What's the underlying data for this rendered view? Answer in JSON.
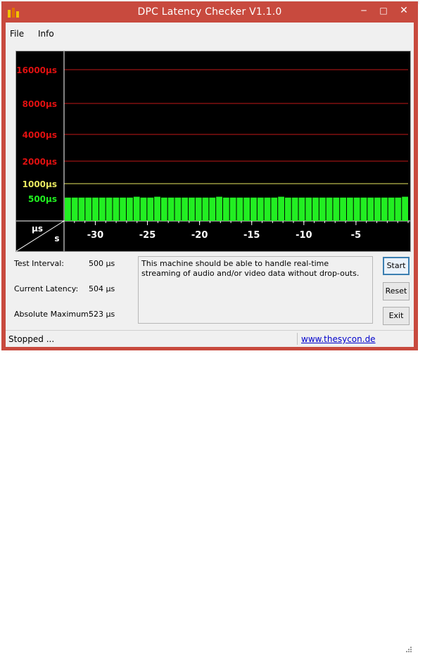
{
  "window": {
    "title": "DPC Latency Checker V1.1.0"
  },
  "menu": {
    "items": [
      "File",
      "Info"
    ]
  },
  "graph": {
    "y_labels": [
      {
        "text": "16000µs",
        "color": "#e01010"
      },
      {
        "text": "8000µs",
        "color": "#e01010"
      },
      {
        "text": "4000µs",
        "color": "#e01010"
      },
      {
        "text": "2000µs",
        "color": "#e01010"
      },
      {
        "text": "1000µs",
        "color": "#e8e860"
      },
      {
        "text": "500µs",
        "color": "#20f020"
      }
    ],
    "corner_top": "µs",
    "corner_bottom": "s",
    "x_ticks": [
      "-30",
      "-25",
      "-20",
      "-15",
      "-10",
      "-5"
    ],
    "bar_color": "#22ee22",
    "grid_colors": {
      "red": "#c01818",
      "yellow": "#e8e860"
    },
    "bars": [
      504,
      504,
      504,
      504,
      504,
      504,
      504,
      504,
      504,
      504,
      523,
      504,
      504,
      523,
      504,
      504,
      504,
      504,
      504,
      504,
      504,
      504,
      523,
      504,
      504,
      504,
      504,
      504,
      504,
      504,
      504,
      523,
      504,
      504,
      504,
      504,
      504,
      504,
      504,
      504,
      504,
      504,
      504,
      504,
      504,
      504,
      504,
      504,
      504,
      523
    ]
  },
  "info": {
    "test_interval_label": "Test Interval:",
    "test_interval_value": "500 µs",
    "current_latency_label": "Current Latency:",
    "current_latency_value": "504 µs",
    "absolute_maximum_label": "Absolute Maximum:",
    "absolute_maximum_value": "523 µs"
  },
  "message": "This machine should be able to handle real-time streaming of audio and/or video data without drop-outs.",
  "buttons": {
    "start": "Start",
    "reset": "Reset",
    "exit": "Exit"
  },
  "status": {
    "text": "Stopped ...",
    "link": "www.thesycon.de"
  }
}
